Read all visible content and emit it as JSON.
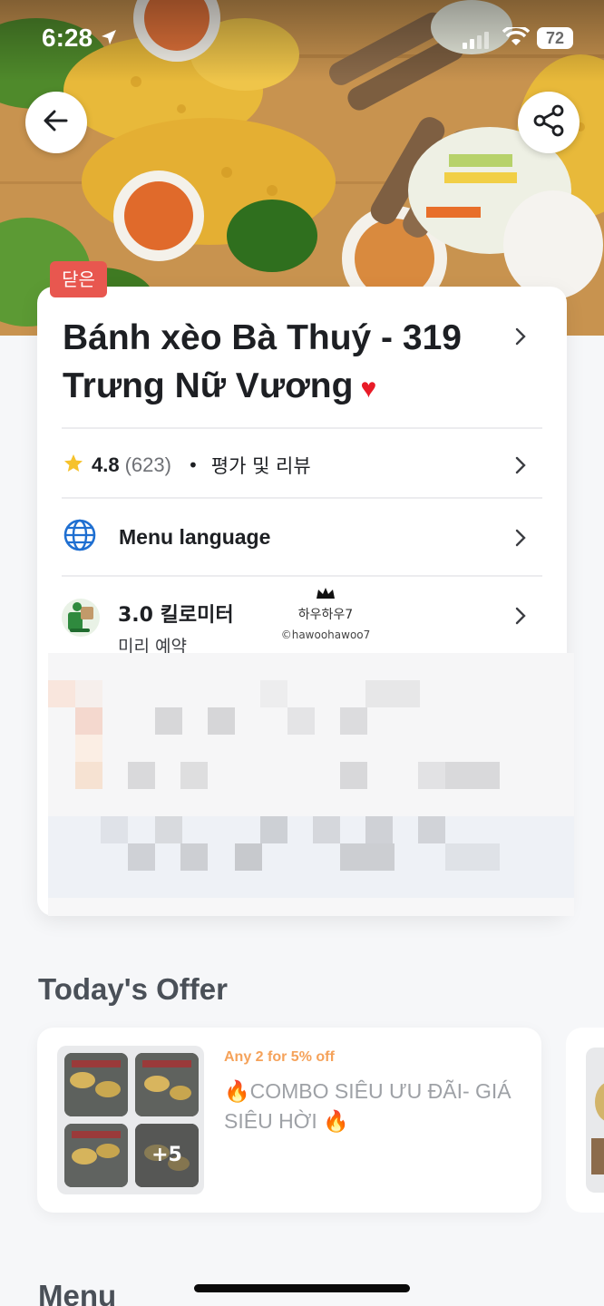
{
  "status_bar": {
    "time": "6:28",
    "battery": "72"
  },
  "hero": {
    "closed_badge": "닫은"
  },
  "restaurant": {
    "name": "Bánh xèo Bà Thuý - 319 Trưng Nữ Vương",
    "favorited": true
  },
  "rating": {
    "value": "4.8",
    "count": "(623)",
    "separator": "•",
    "review_link": "평가 및 리뷰"
  },
  "menu_language": {
    "label": "Menu language"
  },
  "distance": {
    "value": "3.0 킬로미터",
    "sub": "미리 예약"
  },
  "watermark": {
    "name": "하우하우7",
    "handle": "©hawoohawoo7"
  },
  "offers": {
    "section_title": "Today's Offer",
    "items": [
      {
        "promo": "Any 2 for 5% off",
        "title": "🔥COMBO SIÊU ƯU ĐÃI- GIÁ SIÊU HỜI 🔥",
        "more_count": "+5"
      }
    ]
  },
  "menu": {
    "section_title": "Menu"
  },
  "colors": {
    "accent_red": "#e8574f",
    "heart": "#e81b27",
    "promo_orange": "#f5a25a",
    "star": "#f6c22c",
    "globe": "#1f6fd1"
  }
}
